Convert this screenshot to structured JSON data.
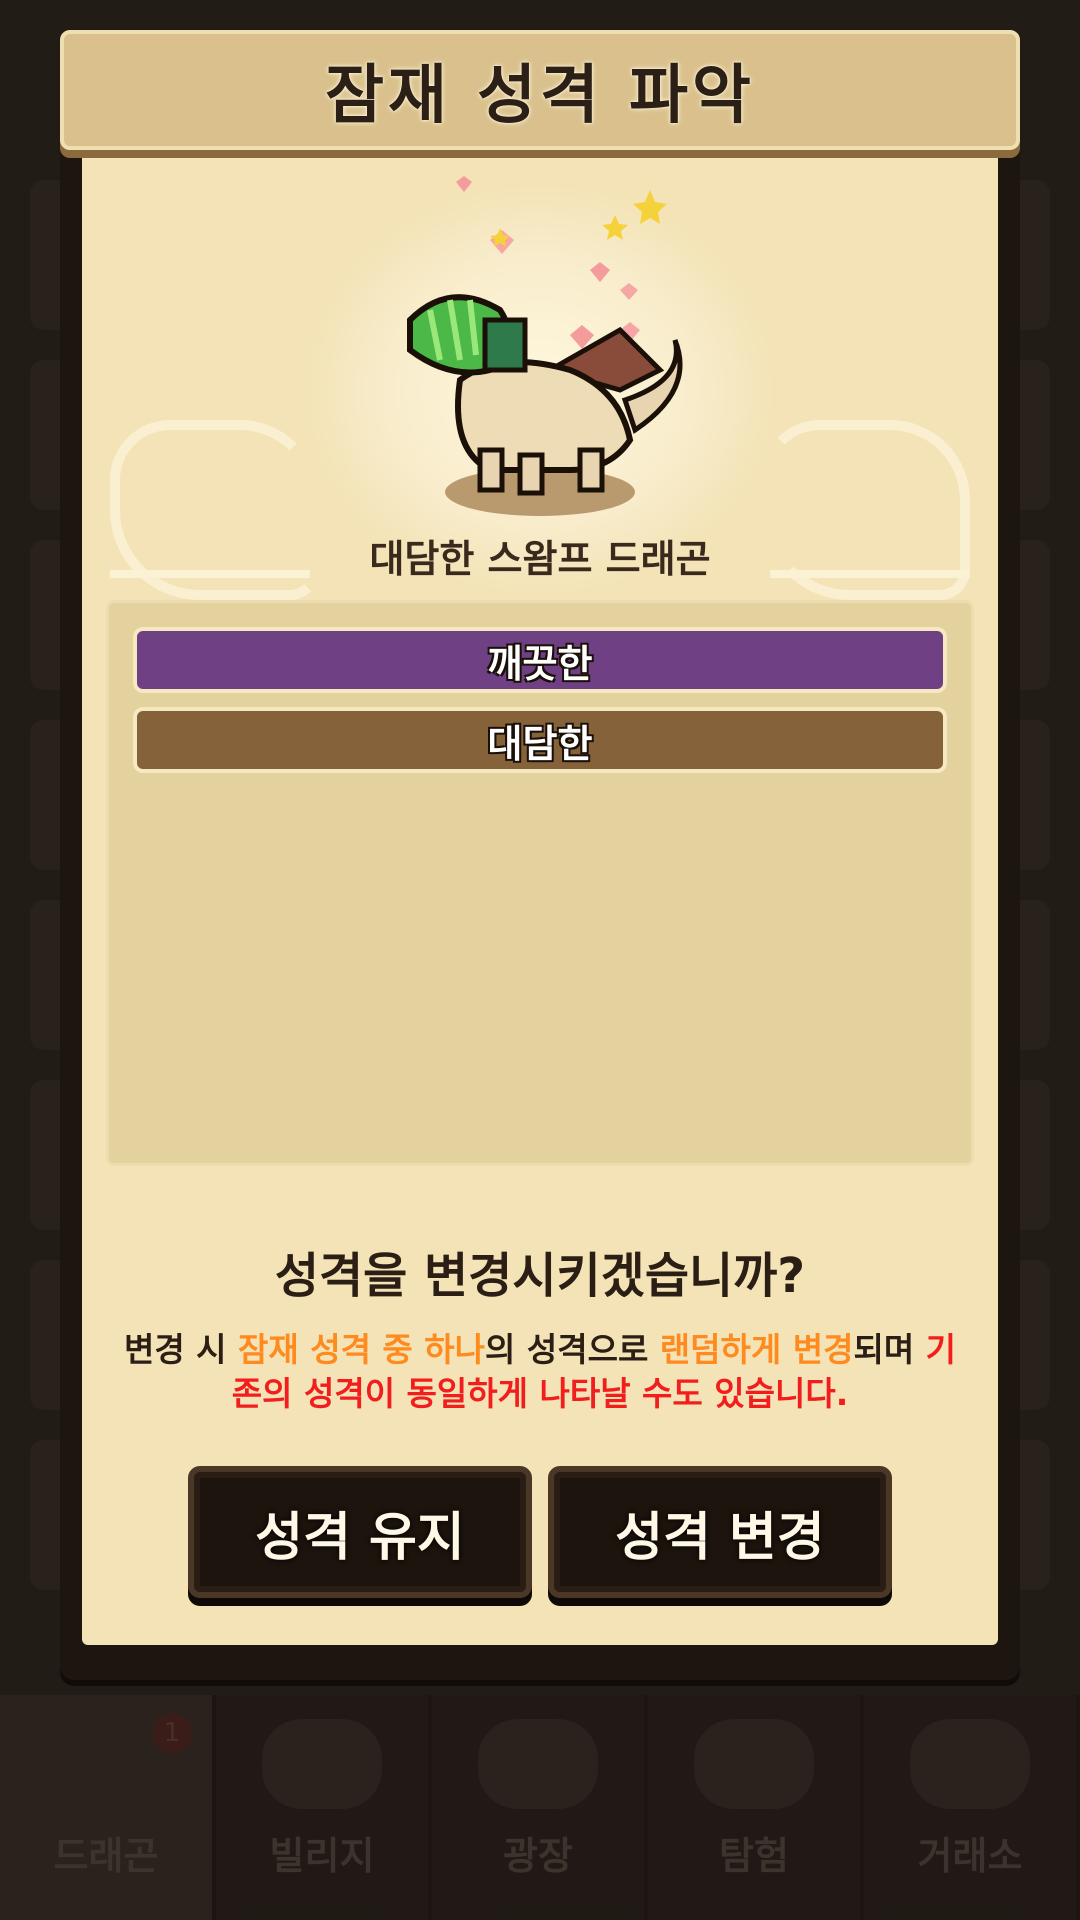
{
  "dialog": {
    "title": "잠재 성격 파악",
    "dragon_name": "대담한 스왐프 드래곤",
    "traits": [
      "깨끗한",
      "대담한"
    ],
    "question": "성격을 변경시키겠습니까?",
    "notice": {
      "p1": "변경 시 ",
      "p2": "잠재 성격 중 하나",
      "p3": "의 성격으로 ",
      "p4": "랜덤하게 변경",
      "p5": "되며 ",
      "p6": "기존의 성격이 동일하게 나타날 수도 있습니다."
    },
    "buttons": {
      "keep": "성격 유지",
      "change": "성격 변경"
    }
  },
  "bottom_nav": {
    "items": [
      "드래곤",
      "빌리지",
      "광장",
      "탐험",
      "거래소"
    ],
    "badge_count": "1"
  },
  "colors": {
    "trait_primary": "#6f4083",
    "trait_secondary": "#86623a",
    "highlight_orange": "#ff8a1e",
    "highlight_red": "#f21d1d"
  }
}
